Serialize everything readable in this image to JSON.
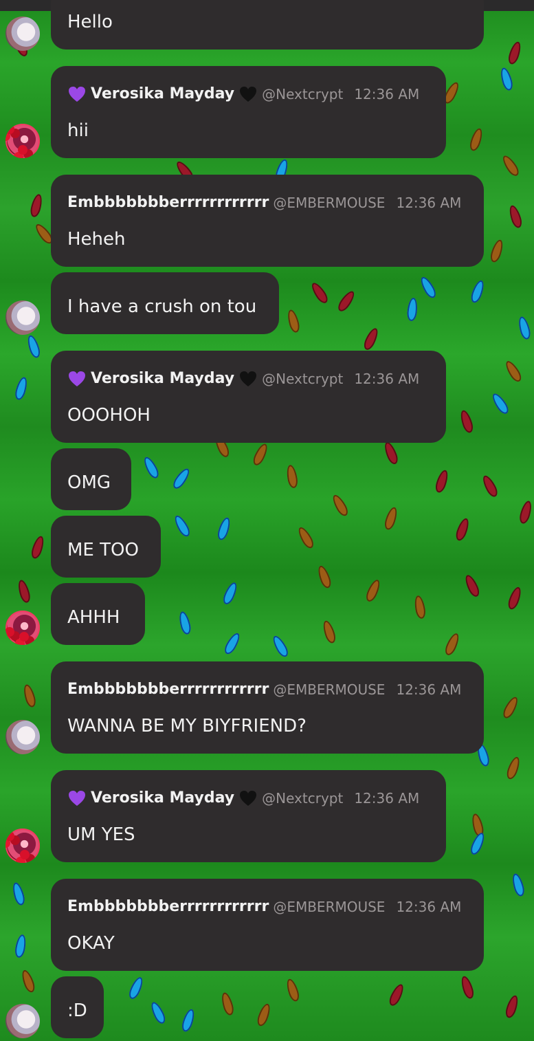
{
  "messages": [
    {
      "id": "m1",
      "type": "plain",
      "body": "Hello",
      "avatar": "ember"
    },
    {
      "id": "m2",
      "type": "header",
      "name": "Verosika Mayday",
      "handle": "@Nextcrypt",
      "time": "12:36 AM",
      "body": "hii",
      "prefix_icon": "purple-heart-icon",
      "suffix_icon": "black-heart-icon",
      "avatar": "vero"
    },
    {
      "id": "m3",
      "type": "header",
      "name": "Embbbbbbberrrrrrrrrrrr",
      "handle": "@EMBERMOUSE",
      "time": "12:36 AM",
      "body": "Heheh",
      "avatar": "ember"
    },
    {
      "id": "m4",
      "type": "plain",
      "body": "I have a crush  on tou",
      "avatar": "ember"
    },
    {
      "id": "m5",
      "type": "header",
      "name": "Verosika Mayday",
      "handle": "@Nextcrypt",
      "time": "12:36 AM",
      "body": "OOOHOH",
      "prefix_icon": "purple-heart-icon",
      "suffix_icon": "black-heart-icon",
      "avatar": "vero"
    },
    {
      "id": "m6",
      "type": "plain",
      "body": "OMG",
      "avatar": "vero"
    },
    {
      "id": "m7",
      "type": "plain",
      "body": "ME TOO",
      "avatar": "vero"
    },
    {
      "id": "m8",
      "type": "plain",
      "body": "AHHH",
      "avatar": "vero"
    },
    {
      "id": "m9",
      "type": "header",
      "name": "Embbbbbbberrrrrrrrrrrr",
      "handle": "@EMBERMOUSE",
      "time": "12:36 AM",
      "body": "WANNA BE MY BIYFRIEND?",
      "avatar": "ember"
    },
    {
      "id": "m10",
      "type": "header",
      "name": "Verosika Mayday",
      "handle": "@Nextcrypt",
      "time": "12:36 AM",
      "body": "UM YES",
      "prefix_icon": "purple-heart-icon",
      "suffix_icon": "black-heart-icon",
      "avatar": "vero"
    },
    {
      "id": "m11",
      "type": "header",
      "name": "Embbbbbbberrrrrrrrrrrr",
      "handle": "@EMBERMOUSE",
      "time": "12:36 AM",
      "body": "OKAY",
      "avatar": "ember"
    },
    {
      "id": "m12",
      "type": "plain",
      "body": ":D",
      "avatar": "ember"
    }
  ]
}
